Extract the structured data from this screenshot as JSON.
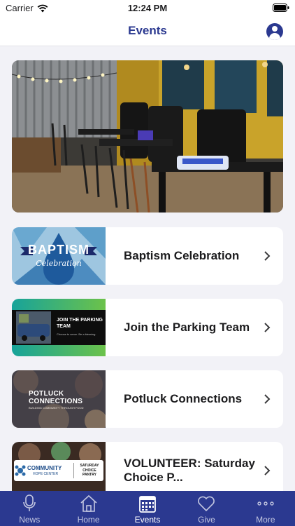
{
  "status_bar": {
    "carrier": "Carrier",
    "time": "12:24 PM"
  },
  "nav": {
    "title": "Events",
    "profile_icon": "person-circle-icon"
  },
  "hero": {
    "image": "cafe-seating-photo"
  },
  "events": [
    {
      "title": "Baptism Celebration",
      "thumb_text": "BAPTISM",
      "thumb_script": "Celebration"
    },
    {
      "title": "Join the Parking Team",
      "thumb_text": "JOIN THE PARKING TEAM",
      "thumb_sub": "Choose to serve. Be a blessing."
    },
    {
      "title": "Potluck Connections",
      "thumb_text": "POTLUCK CONNECTIONS",
      "thumb_sub": "BUILDING COMMUNITY THROUGH FOOD"
    },
    {
      "title": "VOLUNTEER: Saturday Choice P...",
      "thumb_text": "COMMUNITY",
      "thumb_sub": "HOPE CENTER",
      "thumb_right": "SATURDAY CHOICE PANTRY"
    }
  ],
  "tabs": [
    {
      "label": "News",
      "icon": "microphone-icon",
      "active": false
    },
    {
      "label": "Home",
      "icon": "home-icon",
      "active": false
    },
    {
      "label": "Events",
      "icon": "calendar-icon",
      "active": true
    },
    {
      "label": "Give",
      "icon": "heart-icon",
      "active": false
    },
    {
      "label": "More",
      "icon": "ellipsis-icon",
      "active": false
    }
  ],
  "colors": {
    "brand": "#2b3990",
    "background": "#f2f2f7"
  }
}
